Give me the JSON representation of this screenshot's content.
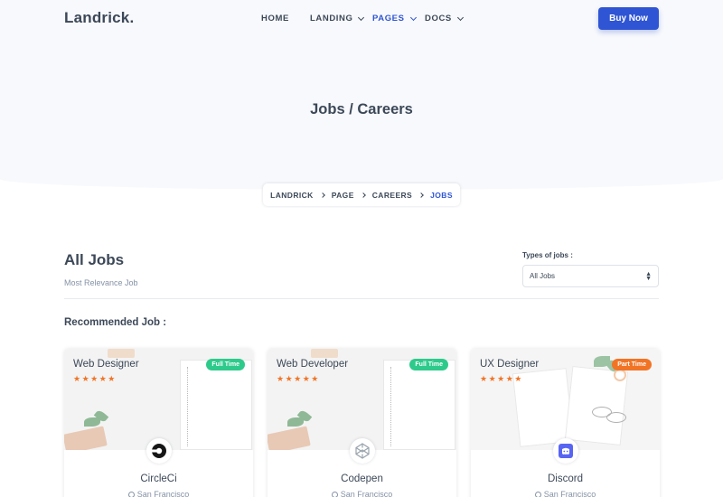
{
  "brand": {
    "name": "Landrick."
  },
  "nav": {
    "items": [
      {
        "label": "HOME",
        "dropdown": false,
        "active": false
      },
      {
        "label": "LANDING",
        "dropdown": true,
        "active": false
      },
      {
        "label": "PAGES",
        "dropdown": true,
        "active": true
      },
      {
        "label": "DOCS",
        "dropdown": true,
        "active": false
      }
    ],
    "cta": "Buy Now"
  },
  "hero": {
    "title": "Jobs / Careers"
  },
  "breadcrumb": [
    "LANDRICK",
    "PAGE",
    "CAREERS",
    "JOBS"
  ],
  "jobs_section": {
    "title": "All Jobs",
    "subtitle": "Most Relevance Job",
    "filter_label": "Types of jobs :",
    "filter_value": "All Jobs",
    "recommended_title": "Recommended Job :"
  },
  "cards": [
    {
      "title": "Web Designer",
      "badge": "Full Time",
      "stars": "★★★★★",
      "company": "CircleCi",
      "location": "San Francisco",
      "logo_icon": "circleci-icon"
    },
    {
      "title": "Web Developer",
      "badge": "Full Time",
      "stars": "★★★★★",
      "company": "Codepen",
      "location": "San Francisco",
      "logo_icon": "codepen-icon"
    },
    {
      "title": "UX Designer",
      "badge": "Part Time",
      "stars": "★★★★★",
      "company": "Discord",
      "location": "San Francisco",
      "logo_icon": "discord-icon"
    }
  ],
  "colors": {
    "primary": "#2f55d4",
    "text": "#3c4858",
    "muted": "#8492a6",
    "star": "#f17425",
    "badge_full_time": "#2eca8b",
    "badge_part_time": "#f17425",
    "hero_bg": "#f8f9fc"
  }
}
